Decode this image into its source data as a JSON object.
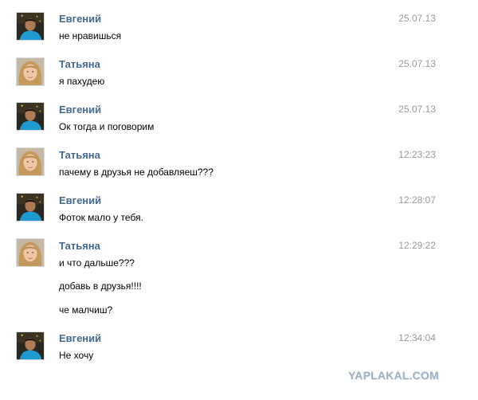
{
  "messages": [
    {
      "author": "Евгений",
      "time": "25.07.13",
      "lines": [
        "не нравишься"
      ],
      "avatar": "evgeniy-avatar"
    },
    {
      "author": "Татьяна",
      "time": "25.07.13",
      "lines": [
        "я пахудею"
      ],
      "avatar": "tatyana-avatar"
    },
    {
      "author": "Евгений",
      "time": "25.07.13",
      "lines": [
        "Ок тогда и поговорим"
      ],
      "avatar": "evgeniy-avatar"
    },
    {
      "author": "Татьяна",
      "time": "12:23:23",
      "lines": [
        "пачему в друзья не добавляеш???"
      ],
      "avatar": "tatyana-avatar"
    },
    {
      "author": "Евгений",
      "time": "12:28:07",
      "lines": [
        "Фоток мало у тебя."
      ],
      "avatar": "evgeniy-avatar"
    },
    {
      "author": "Татьяна",
      "time": "12:29:22",
      "lines": [
        "и что дальше???",
        "добавь в друзья!!!!",
        "че малчиш?"
      ],
      "avatar": "tatyana-avatar"
    },
    {
      "author": "Евгений",
      "time": "12:34:04",
      "lines": [
        "Не хочу"
      ],
      "avatar": "evgeniy-avatar"
    }
  ],
  "watermark": "YAPLAKAL.COM",
  "colors": {
    "author": "#45688e",
    "time": "#999999",
    "text": "#000000"
  }
}
